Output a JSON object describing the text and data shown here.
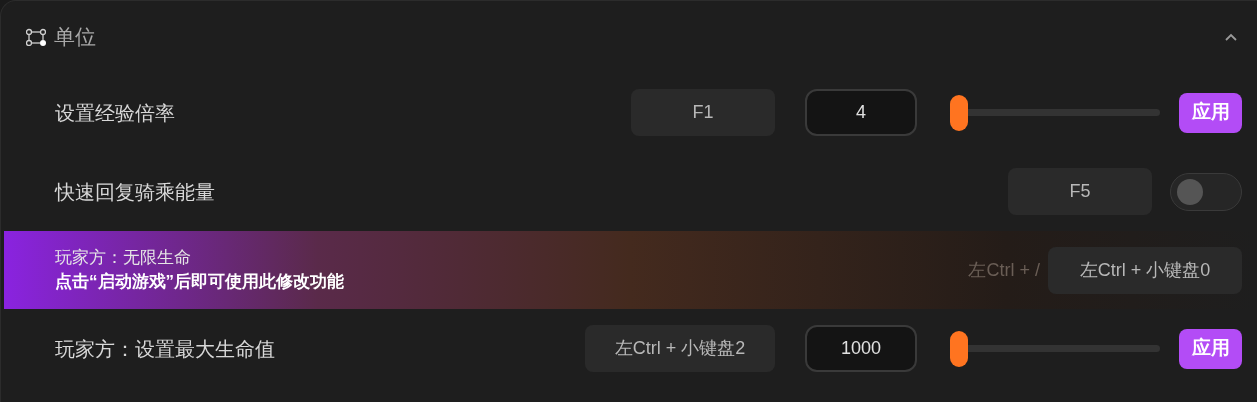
{
  "section": {
    "title": "单位",
    "expanded": true
  },
  "rows": [
    {
      "kind": "slider",
      "label": "设置经验倍率",
      "hotkey": "F1",
      "value": "4",
      "level": 0.02,
      "apply": "应用"
    },
    {
      "kind": "toggle",
      "label": "快速回复骑乘能量",
      "hotkey": "F5",
      "on": false
    },
    {
      "kind": "locked",
      "label": "玩家方：无限生命",
      "notice": "点击“启动游戏”后即可使用此修改功能",
      "faded": "左Ctrl + /",
      "hotkey": "左Ctrl + 小键盘0"
    },
    {
      "kind": "slider",
      "label": "玩家方：设置最大生命值",
      "hotkey": "左Ctrl + 小键盘2",
      "value": "1000",
      "level": 0.02,
      "apply": "应用"
    }
  ]
}
